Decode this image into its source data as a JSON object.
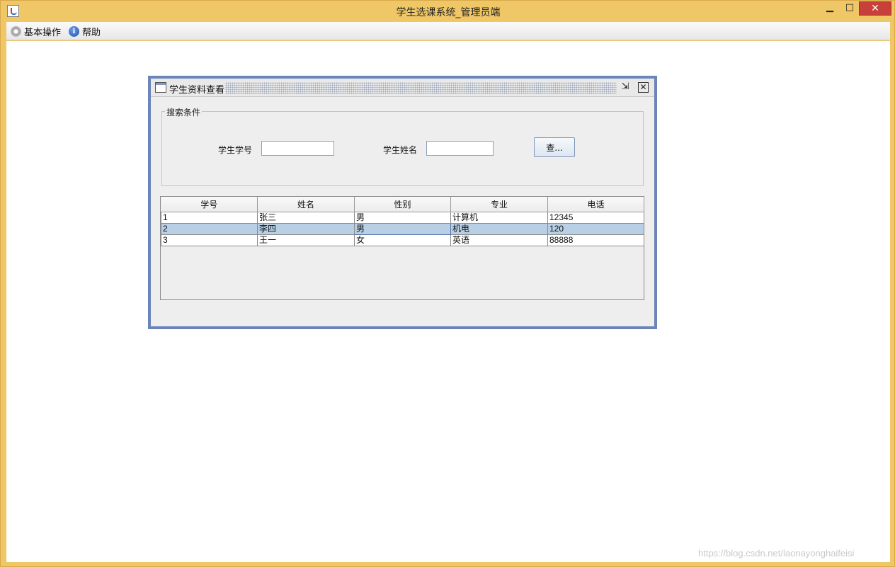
{
  "window": {
    "title": "学生选课系统_管理员端",
    "minimize_glyph": "▁",
    "maximize_glyph": "□",
    "close_glyph": "✕"
  },
  "menubar": {
    "items": [
      {
        "label": "基本操作",
        "icon": "gear-icon"
      },
      {
        "label": "帮助",
        "icon": "info-icon"
      }
    ]
  },
  "internal_frame": {
    "title": "学生资料查看",
    "restore_glyph": "⇲",
    "close_glyph": "✕"
  },
  "search": {
    "group_title": "搜索条件",
    "student_id_label": "学生学号",
    "student_id_value": "",
    "student_name_label": "学生姓名",
    "student_name_value": "",
    "button_label": "查..."
  },
  "table": {
    "columns": [
      "学号",
      "姓名",
      "性别",
      "专业",
      "电话"
    ],
    "rows": [
      [
        "1",
        "张三",
        "男",
        "计算机",
        "12345"
      ],
      [
        "2",
        "李四",
        "男",
        "机电",
        "120"
      ],
      [
        "3",
        "王一",
        "女",
        "英语",
        "88888"
      ]
    ],
    "selected_row": 1
  },
  "watermark": "https://blog.csdn.net/laonayonghaifeisi"
}
